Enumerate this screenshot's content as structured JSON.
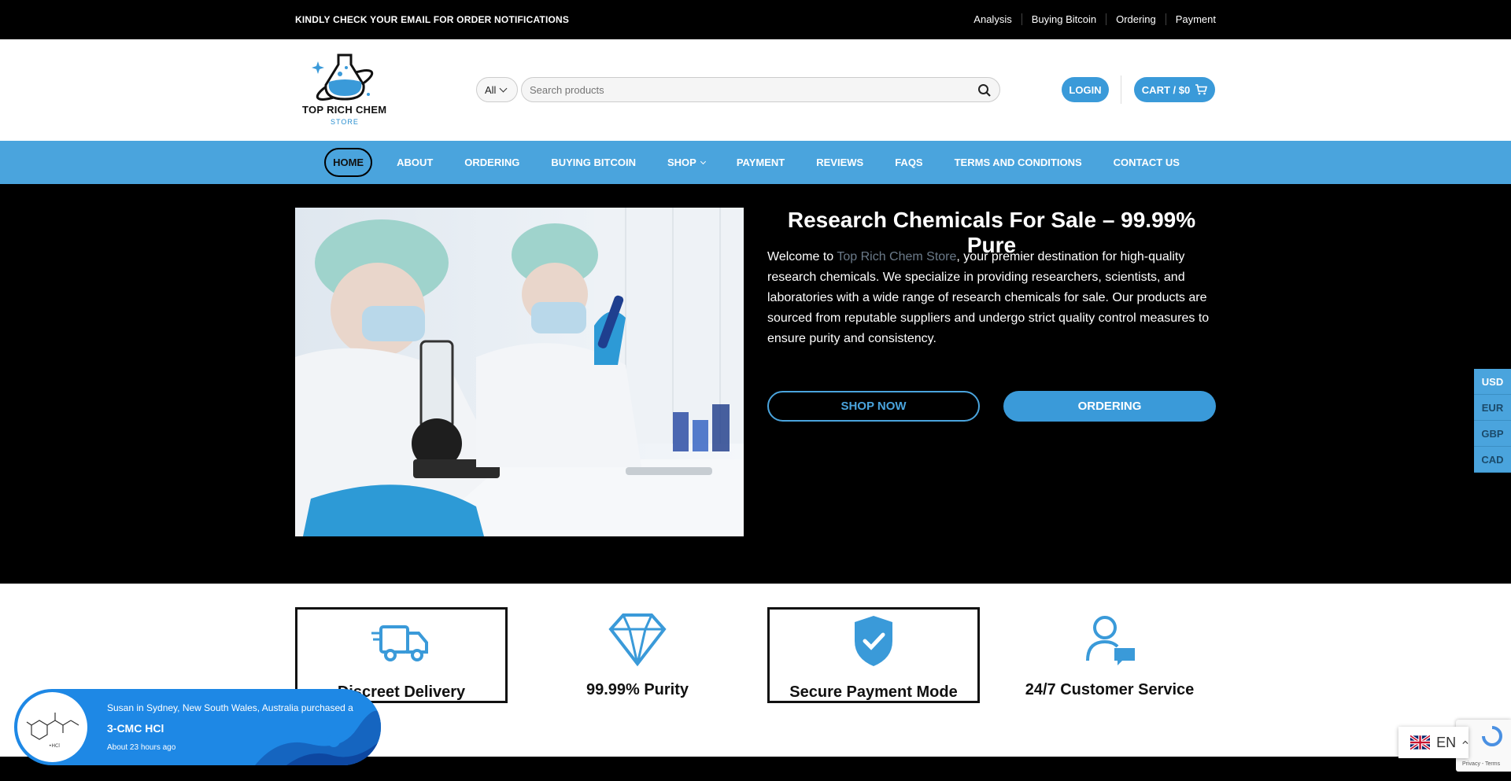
{
  "topbar": {
    "notice": "KINDLY CHECK YOUR EMAIL FOR ORDER NOTIFICATIONS",
    "links": [
      "Analysis",
      "Buying Bitcoin",
      "Ordering",
      "Payment"
    ]
  },
  "header": {
    "logo_text": "TOP RICH CHEM",
    "logo_sub": "STORE",
    "category_select": "All",
    "search_placeholder": "Search products",
    "login_label": "LOGIN",
    "cart_label": "CART / $0"
  },
  "nav": {
    "items": [
      "HOME",
      "ABOUT",
      "ORDERING",
      "BUYING BITCOIN",
      "SHOP",
      "PAYMENT",
      "REVIEWS",
      "FAQS",
      "TERMS AND CONDITIONS",
      "CONTACT US"
    ]
  },
  "hero": {
    "title": "Research Chemicals For Sale – 99.99% Pure",
    "text_before": "Welcome to ",
    "brand_link": "Top Rich Chem Store",
    "text_after": ", your premier destination for high-quality research chemicals. We specialize in providing researchers, scientists, and laboratories with a wide range of research chemicals for sale. Our products are sourced from reputable suppliers and undergo strict quality control measures to ensure purity and consistency.",
    "shop_now": "SHOP NOW",
    "ordering": "ORDERING"
  },
  "features": [
    {
      "label": "Discreet Delivery",
      "icon": "truck-icon"
    },
    {
      "label": "99.99% Purity",
      "icon": "diamond-icon"
    },
    {
      "label": "Secure Payment Mode",
      "icon": "shield-check-icon"
    },
    {
      "label": "24/7 Customer Service",
      "icon": "user-chat-icon"
    }
  ],
  "currency": [
    "USD",
    "EUR",
    "GBP",
    "CAD"
  ],
  "popup": {
    "line1": "Susan in Sydney, New South Wales, Australia purchased a",
    "product": "3-CMC HCl",
    "time": "About 23 hours ago"
  },
  "language": {
    "code": "EN"
  },
  "recaptcha": {
    "text": "Privacy - Terms"
  },
  "colors": {
    "accent": "#4aa4dd",
    "button": "#3a9ad9",
    "popup": "#1e88e5"
  }
}
